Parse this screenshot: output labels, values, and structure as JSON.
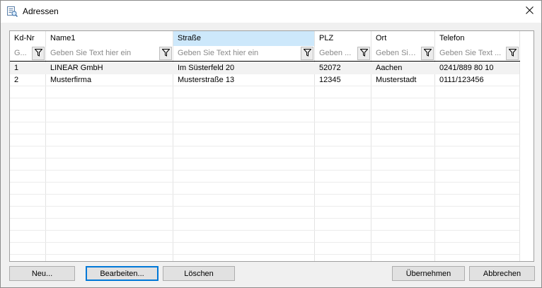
{
  "window": {
    "title": "Adressen",
    "title_icon": "address-book-icon",
    "close_icon": "close-icon"
  },
  "columns": [
    {
      "label": "Kd-Nr",
      "filter_placeholder": "G..."
    },
    {
      "label": "Name1",
      "filter_placeholder": "Geben Sie Text hier ein"
    },
    {
      "label": "Straße",
      "filter_placeholder": "Geben Sie Text hier ein"
    },
    {
      "label": "PLZ",
      "filter_placeholder": "Geben ..."
    },
    {
      "label": "Ort",
      "filter_placeholder": "Geben Sie..."
    },
    {
      "label": "Telefon",
      "filter_placeholder": "Geben Sie Text ..."
    }
  ],
  "rows": [
    [
      "1",
      "LINEAR GmbH",
      "Im Süsterfeld 20",
      "52072",
      "Aachen",
      "0241/889 80 10"
    ],
    [
      "2",
      "Musterfirma",
      "Musterstraße 13",
      "12345",
      "Musterstadt",
      "0111/123456"
    ]
  ],
  "buttons": {
    "new": "Neu...",
    "edit": "Bearbeiten...",
    "delete": "Löschen",
    "accept": "Übernehmen",
    "cancel": "Abbrechen"
  },
  "colors": {
    "selected_header": "#cde8fb",
    "default_button_border": "#0078d7"
  }
}
